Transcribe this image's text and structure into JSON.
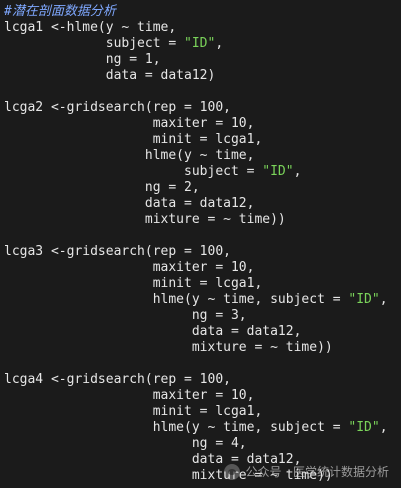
{
  "code_lines": [
    {
      "parts": [
        {
          "t": "#潜在剖面数据分析",
          "c": "comment"
        }
      ]
    },
    {
      "parts": [
        {
          "t": "lcga1 <-hlme(y ~ time,",
          "c": ""
        }
      ]
    },
    {
      "parts": [
        {
          "t": "             subject = ",
          "c": ""
        },
        {
          "t": "\"ID\"",
          "c": "str"
        },
        {
          "t": ",",
          "c": ""
        }
      ]
    },
    {
      "parts": [
        {
          "t": "             ng = 1,",
          "c": ""
        }
      ]
    },
    {
      "parts": [
        {
          "t": "             data = data12)",
          "c": ""
        }
      ]
    },
    {
      "parts": [
        {
          "t": "",
          "c": ""
        }
      ]
    },
    {
      "parts": [
        {
          "t": "lcga2 <-gridsearch(rep = 100,",
          "c": ""
        }
      ]
    },
    {
      "parts": [
        {
          "t": "                   maxiter = 10,",
          "c": ""
        }
      ]
    },
    {
      "parts": [
        {
          "t": "                   minit = lcga1,",
          "c": ""
        }
      ]
    },
    {
      "parts": [
        {
          "t": "                  hlme(y ~ time,",
          "c": ""
        }
      ]
    },
    {
      "parts": [
        {
          "t": "                       subject = ",
          "c": ""
        },
        {
          "t": "\"ID\"",
          "c": "str"
        },
        {
          "t": ",",
          "c": ""
        }
      ]
    },
    {
      "parts": [
        {
          "t": "                  ng = 2,",
          "c": ""
        }
      ]
    },
    {
      "parts": [
        {
          "t": "                  data = data12,",
          "c": ""
        }
      ]
    },
    {
      "parts": [
        {
          "t": "                  mixture = ~ time))",
          "c": ""
        }
      ]
    },
    {
      "parts": [
        {
          "t": "",
          "c": ""
        }
      ]
    },
    {
      "parts": [
        {
          "t": "lcga3 <-gridsearch(rep = 100,",
          "c": ""
        }
      ]
    },
    {
      "parts": [
        {
          "t": "                   maxiter = 10,",
          "c": ""
        }
      ]
    },
    {
      "parts": [
        {
          "t": "                   minit = lcga1,",
          "c": ""
        }
      ]
    },
    {
      "parts": [
        {
          "t": "                   hlme(y ~ time, subject = ",
          "c": ""
        },
        {
          "t": "\"ID\"",
          "c": "str"
        },
        {
          "t": ",",
          "c": ""
        }
      ]
    },
    {
      "parts": [
        {
          "t": "                        ng = 3,",
          "c": ""
        }
      ]
    },
    {
      "parts": [
        {
          "t": "                        data = data12,",
          "c": ""
        }
      ]
    },
    {
      "parts": [
        {
          "t": "                        mixture = ~ time))",
          "c": ""
        }
      ]
    },
    {
      "parts": [
        {
          "t": "",
          "c": ""
        }
      ]
    },
    {
      "parts": [
        {
          "t": "lcga4 <-gridsearch(rep = 100,",
          "c": ""
        }
      ]
    },
    {
      "parts": [
        {
          "t": "                   maxiter = 10,",
          "c": ""
        }
      ]
    },
    {
      "parts": [
        {
          "t": "                   minit = lcga1,",
          "c": ""
        }
      ]
    },
    {
      "parts": [
        {
          "t": "                   hlme(y ~ time, subject = ",
          "c": ""
        },
        {
          "t": "\"ID\"",
          "c": "str"
        },
        {
          "t": ",",
          "c": ""
        }
      ]
    },
    {
      "parts": [
        {
          "t": "                        ng = 4,",
          "c": ""
        }
      ]
    },
    {
      "parts": [
        {
          "t": "                        data = data12,",
          "c": ""
        }
      ]
    },
    {
      "parts": [
        {
          "t": "                        mixture = ~ time))",
          "c": ""
        }
      ]
    }
  ],
  "watermark": {
    "text": "公众号 · 医学统计数据分析",
    "icon": "wechat-icon"
  },
  "colors": {
    "background": "#1b1b1b",
    "code_text": "#e6e6e6",
    "comment": "#7fa8ff",
    "string": "#7ad35a"
  }
}
